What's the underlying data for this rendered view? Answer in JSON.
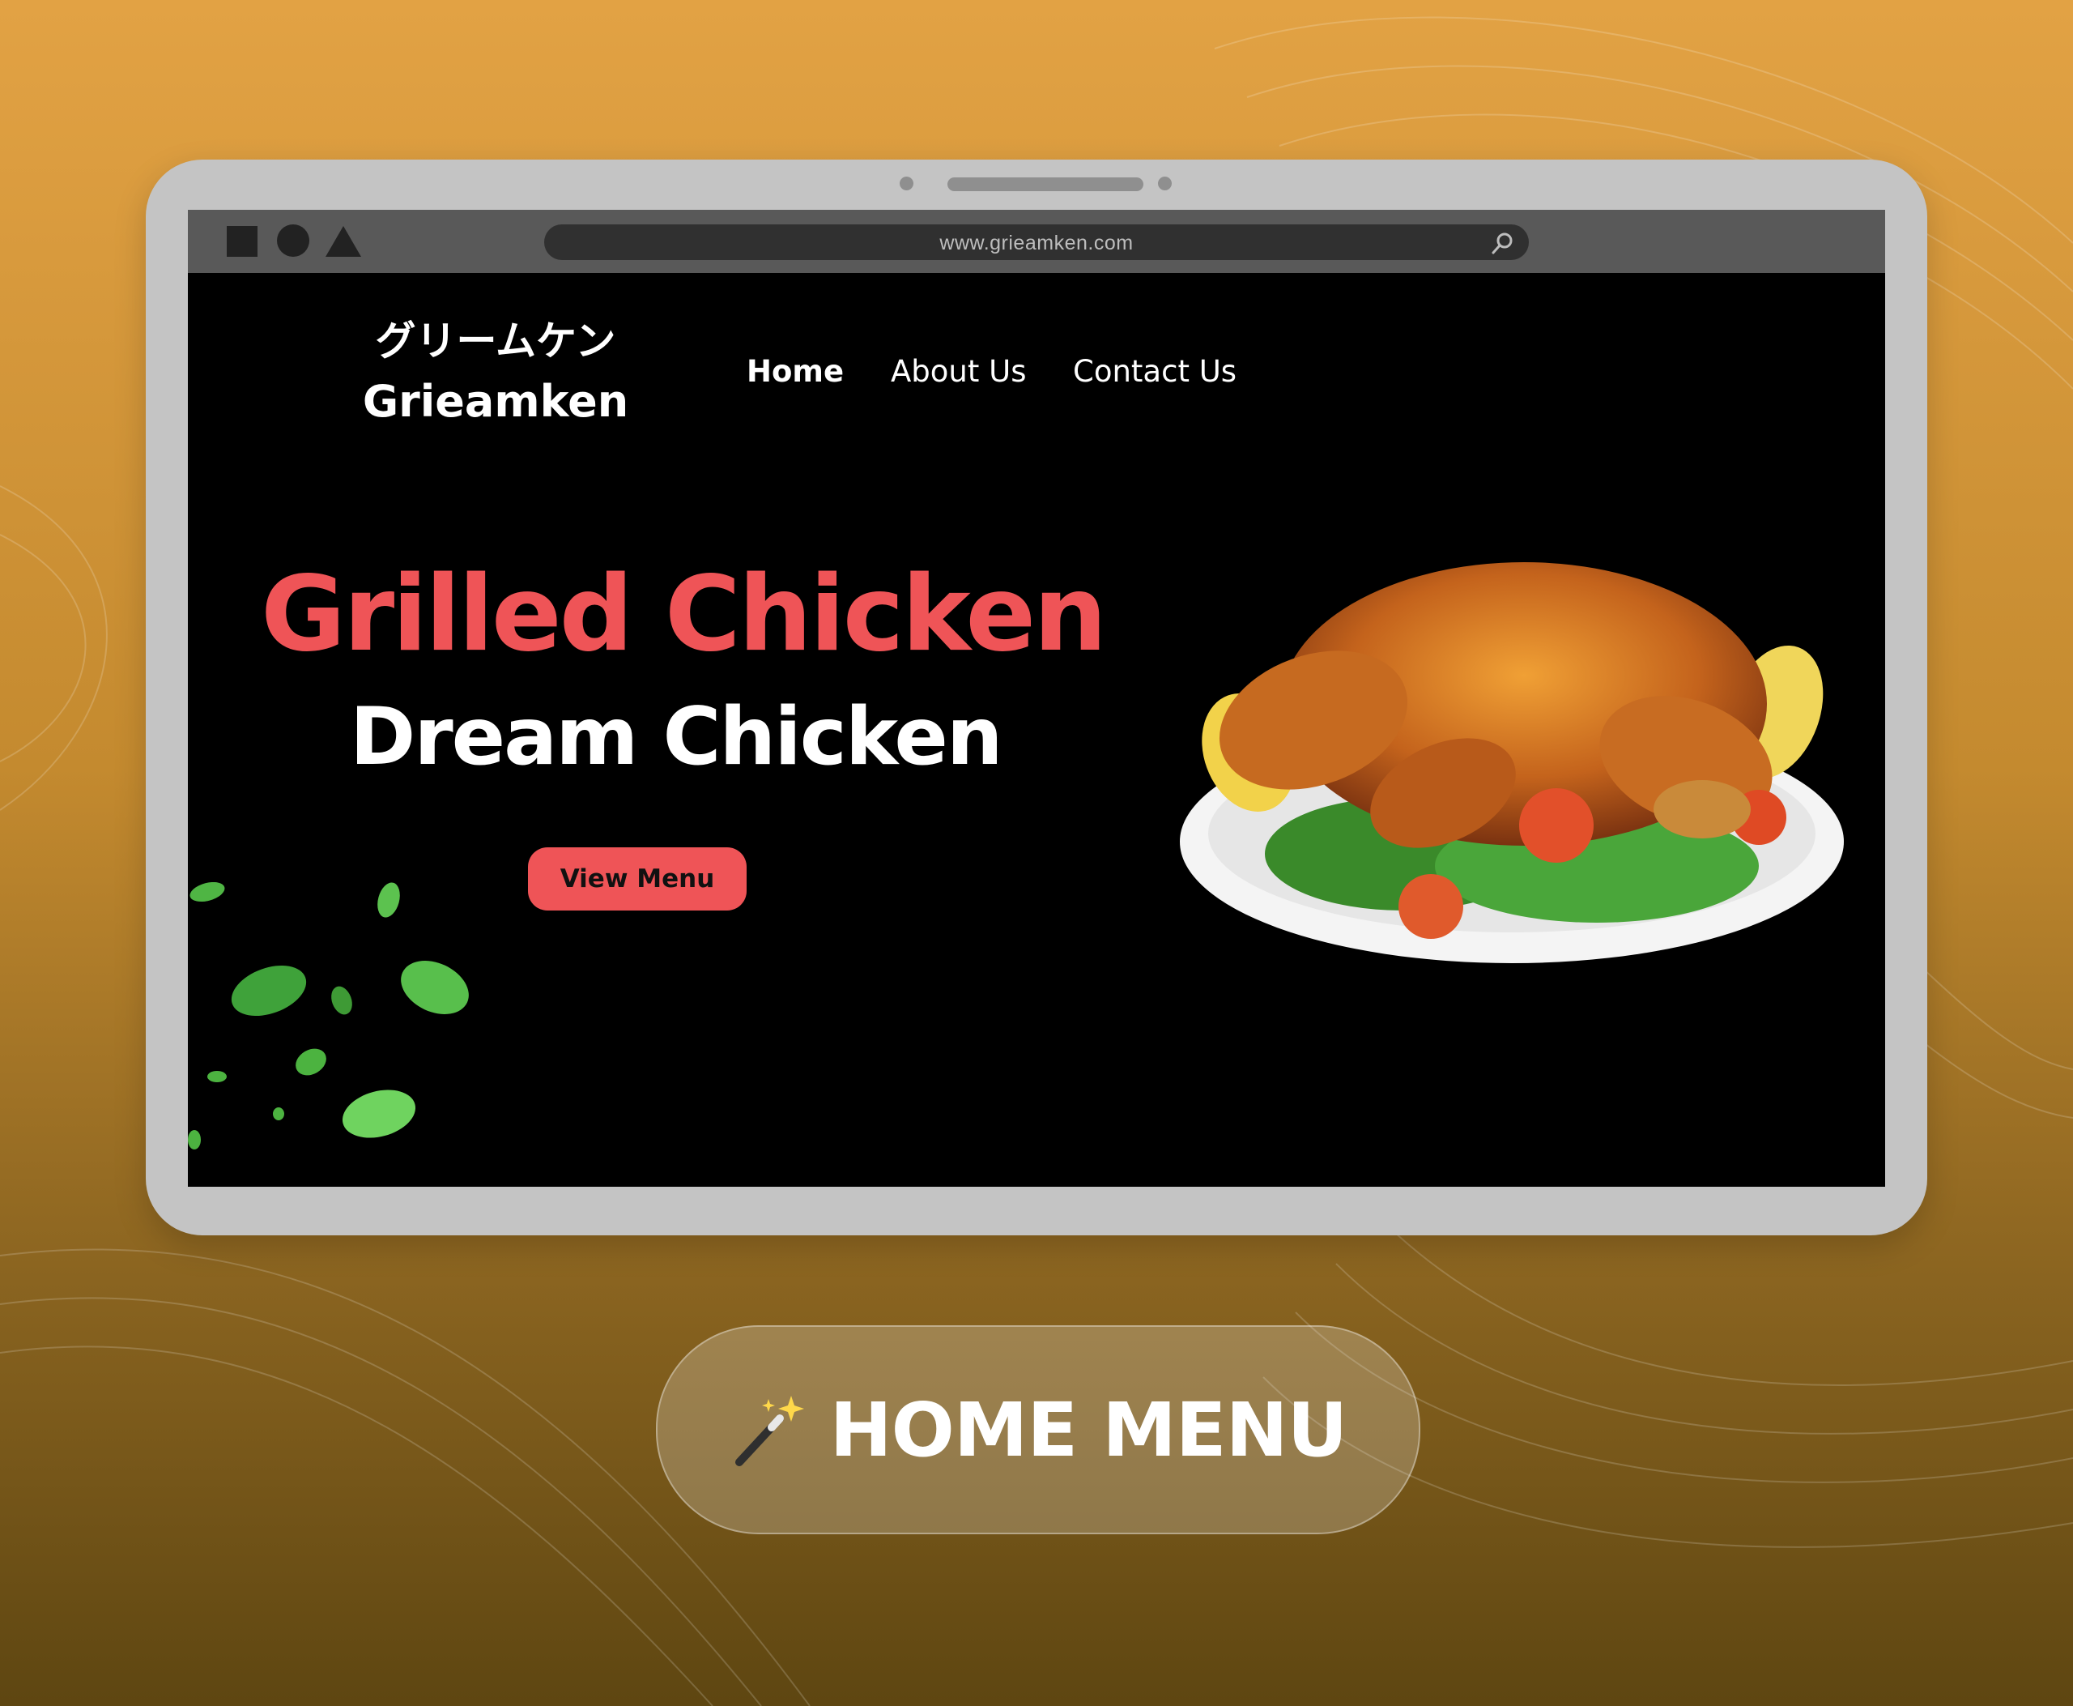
{
  "browser": {
    "url": "www.grieamken.com",
    "window_controls": [
      "square-icon",
      "circle-icon",
      "triangle-icon"
    ],
    "search_icon": "search-icon"
  },
  "site": {
    "logo_jp": "グリームケン",
    "logo_en": "Grieamken",
    "nav": [
      {
        "label": "Home",
        "active": true
      },
      {
        "label": "About Us",
        "active": false
      },
      {
        "label": "Contact Us",
        "active": false
      }
    ]
  },
  "hero": {
    "title": "Grilled Chicken",
    "subtitle": "Dream Chicken",
    "cta_label": "View Menu",
    "image_icon": "roast-chicken-plate",
    "decoration_icon": "leaves"
  },
  "caption": {
    "icon": "magic-wand-icon",
    "label": "HOME MENU"
  },
  "colors": {
    "accent": "#ef5457",
    "background_top": "#e2a244",
    "background_bottom": "#5e4611",
    "frame": "#c4c4c4",
    "screen": "#000000"
  }
}
